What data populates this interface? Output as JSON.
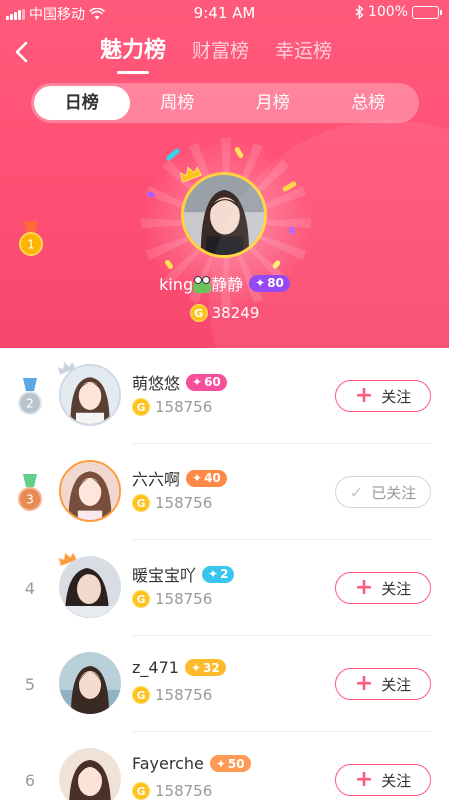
{
  "status_bar": {
    "carrier": "中国移动",
    "time": "9:41 AM",
    "battery": "100%"
  },
  "nav": {
    "tabs": [
      "魅力榜",
      "财富榜",
      "幸运榜"
    ],
    "active_tab": 0
  },
  "periods": {
    "options": [
      "日榜",
      "周榜",
      "月榜",
      "总榜"
    ],
    "active": 0
  },
  "champion": {
    "rank": "1",
    "name": "king",
    "name_suffix": "静静",
    "level": "80",
    "level_color": "#8c3cf5",
    "coins": "38249",
    "coin_symbol": "G"
  },
  "rows": [
    {
      "rank": "2",
      "medal": "silver",
      "name": "萌悠悠",
      "level": "60",
      "level_color": "#f7509a",
      "coins": "158756",
      "follow": "关注",
      "followed": false
    },
    {
      "rank": "3",
      "medal": "bronze",
      "name": "六六啊",
      "level": "40",
      "level_color": "#ff8a47",
      "coins": "158756",
      "follow": "已关注",
      "followed": true
    },
    {
      "rank": "4",
      "name": "暖宝宝吖",
      "level": "2",
      "level_color": "#38c6ee",
      "coins": "158756",
      "follow": "关注",
      "followed": false
    },
    {
      "rank": "5",
      "name": "z_471",
      "level": "32",
      "level_color": "#ffba2c",
      "coins": "158756",
      "follow": "关注",
      "followed": false
    },
    {
      "rank": "6",
      "name": "Fayerche",
      "level": "50",
      "level_color": "#ff9a55",
      "coins": "158756",
      "follow": "关注",
      "followed": false
    }
  ],
  "icons": {
    "back": "chevron-left-icon",
    "coin": "gold-coin-icon",
    "follow": "plus-icon",
    "followed": "check-icon"
  },
  "colors": {
    "accent": "#ff5a7b",
    "gold": "#ffc21a"
  }
}
